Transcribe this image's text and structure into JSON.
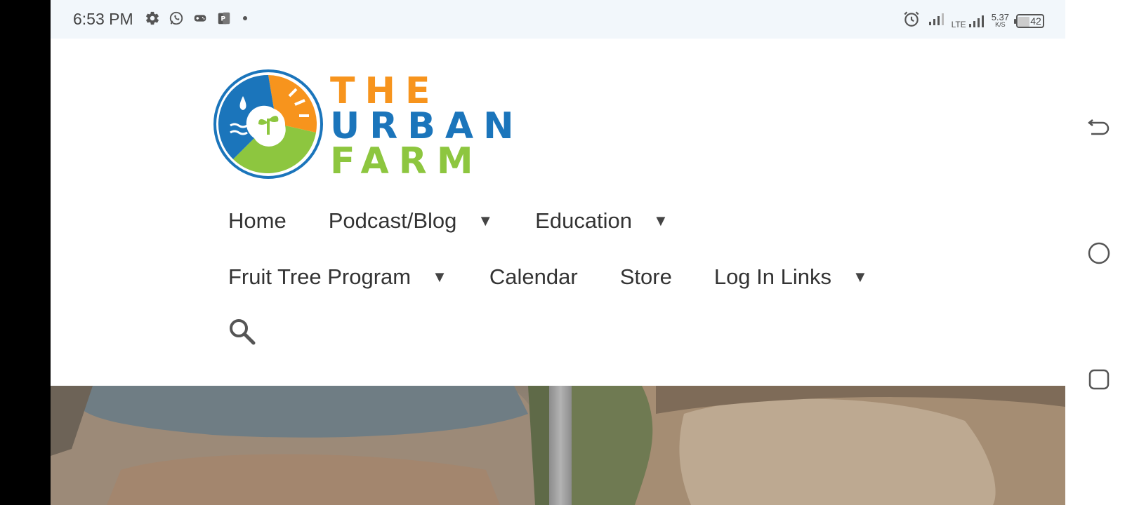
{
  "status_bar": {
    "time": "6:53 PM",
    "left_icons": [
      "gear-icon",
      "whatsapp-icon",
      "game-controller-icon",
      "parking-app-icon",
      "dot-icon"
    ],
    "network_type": "LTE",
    "speed_value": "5.37",
    "speed_unit": "K/S",
    "battery": "42",
    "battery_level": 0.42
  },
  "site": {
    "logo": {
      "line1": "THE",
      "line2": "URBAN",
      "line3": "FARM",
      "colors": {
        "orange": "#f7941d",
        "blue": "#1b75bb",
        "green": "#8dc63f"
      }
    },
    "nav": {
      "row1": [
        {
          "label": "Home",
          "has_dropdown": false
        },
        {
          "label": "Podcast/Blog",
          "has_dropdown": true
        },
        {
          "label": "Education",
          "has_dropdown": true
        }
      ],
      "row2": [
        {
          "label": "Fruit Tree Program",
          "has_dropdown": true
        },
        {
          "label": "Calendar",
          "has_dropdown": false
        },
        {
          "label": "Store",
          "has_dropdown": false
        },
        {
          "label": "Log In Links",
          "has_dropdown": true
        }
      ],
      "caret": "▼",
      "search_icon": "search-icon"
    }
  },
  "system_nav": {
    "buttons": [
      "back-icon",
      "home-circle-icon",
      "recents-square-icon"
    ]
  },
  "colors": {
    "status_bar_bg": "#f2f7fb",
    "nav_text": "#333333",
    "caret": "#444444"
  }
}
